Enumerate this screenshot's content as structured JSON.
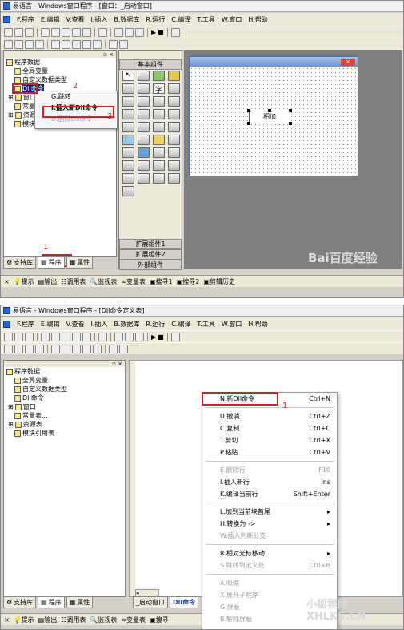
{
  "s1": {
    "title": "易语言 - Windows窗口程序 - [窗口：_启动窗口]",
    "menus": [
      "F.程序",
      "E.编辑",
      "V.查看",
      "I.插入",
      "B.数据库",
      "R.运行",
      "C.编译",
      "T.工具",
      "W.窗口",
      "H.帮助"
    ],
    "tree": {
      "root": "程序数据",
      "items": [
        "全局变量",
        "自定义数据类型",
        "Dll命令",
        "窗口",
        "常量",
        "资源",
        "模块"
      ]
    },
    "popup": {
      "items": [
        {
          "label": "G.跳转",
          "disabled": false
        },
        {
          "label": "I.插入新Dll命令",
          "disabled": false
        },
        {
          "label": "D.删除Dll命令",
          "disabled": true
        }
      ]
    },
    "palette": {
      "header": "基本组件",
      "footer": [
        "扩展组件1",
        "扩展组件2",
        "外部组件"
      ],
      "char_icon": "字"
    },
    "form": {
      "button_label": "相加"
    },
    "bottom_tabs": [
      "支持库",
      "程序",
      "属性"
    ],
    "status": [
      "提示",
      "输出",
      "调用表",
      "监视表",
      "变量表",
      "搜寻1",
      "搜寻2",
      "剪辑历史"
    ],
    "annotations": [
      "1",
      "2",
      "3"
    ],
    "watermark": "Bai百度经验"
  },
  "s2": {
    "title": "易语言 - Windows窗口程序 - [Dll命令定义表]",
    "menus": [
      "F.程序",
      "E.编辑",
      "V.查看",
      "I.插入",
      "B.数据库",
      "R.运行",
      "C.编译",
      "T.工具",
      "W.窗口",
      "H.帮助"
    ],
    "tree": {
      "root": "程序数据",
      "items": [
        "全局变量",
        "自定义数据类型",
        "Dll命令",
        "窗口",
        "常量表...",
        "资源表",
        "模块引用表"
      ]
    },
    "bottom_tabs": [
      "支持库",
      "程序",
      "属性"
    ],
    "doc_tabs": [
      "_启动窗口",
      "Dll命令"
    ],
    "status": [
      "提示",
      "输出",
      "调用表",
      "监视表",
      "变量表",
      "搜寻"
    ],
    "context_menu": [
      {
        "label": "N.新Dll命令",
        "shortcut": "Ctrl+N",
        "disabled": false
      },
      {
        "sep": true
      },
      {
        "label": "U.撤消",
        "shortcut": "Ctrl+Z",
        "disabled": false
      },
      {
        "label": "C.复制",
        "shortcut": "Ctrl+C",
        "disabled": false
      },
      {
        "label": "T.剪切",
        "shortcut": "Ctrl+X",
        "disabled": false
      },
      {
        "label": "P.粘贴",
        "shortcut": "Ctrl+V",
        "disabled": false
      },
      {
        "sep": true
      },
      {
        "label": "E.删除行",
        "shortcut": "F10",
        "disabled": true
      },
      {
        "label": "I.插入新行",
        "shortcut": "Ins",
        "disabled": false
      },
      {
        "label": "K.编译当前行",
        "shortcut": "Shift+Enter",
        "disabled": false
      },
      {
        "sep": true
      },
      {
        "label": "L.加到当前块首尾",
        "shortcut": "▸",
        "disabled": false
      },
      {
        "label": "H.转换为 ->",
        "shortcut": "▸",
        "disabled": false
      },
      {
        "label": "W.插入判断分支",
        "shortcut": "",
        "disabled": true
      },
      {
        "sep": true
      },
      {
        "label": "R.相对光标移动",
        "shortcut": "▸",
        "disabled": false
      },
      {
        "label": "S.跳转到定义处",
        "shortcut": "Ctrl+B",
        "disabled": true
      },
      {
        "sep": true
      },
      {
        "label": "A.收缩",
        "shortcut": "",
        "disabled": true
      },
      {
        "label": "X.展开子程序",
        "shortcut": "",
        "disabled": true
      },
      {
        "label": "G.屏蔽",
        "shortcut": "",
        "disabled": true
      },
      {
        "label": "B.解除屏蔽",
        "shortcut": "",
        "disabled": true
      }
    ],
    "annotation": "1",
    "watermark": "小狐狸网 XHLKS.CN"
  }
}
